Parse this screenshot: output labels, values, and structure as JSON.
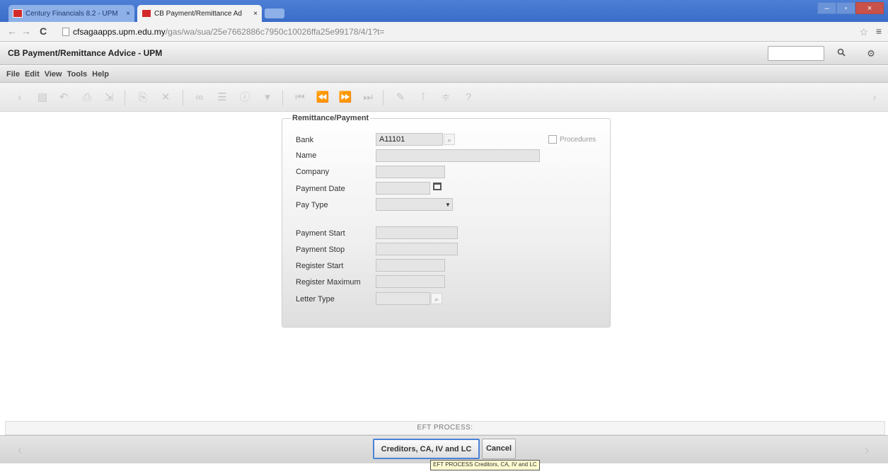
{
  "browser": {
    "tabs": [
      {
        "title": "Century Financials 8.2 - UPM",
        "active": false
      },
      {
        "title": "CB Payment/Remittance Ad",
        "active": true
      }
    ],
    "tab_close": "×",
    "url_host": "cfsagaapps.upm.edu.my",
    "url_path": "/gas/wa/sua/25e7662886c7950c10026ffa25e99178/4/1?t=",
    "window_buttons": {
      "minimize": "–",
      "maximize": "▫",
      "close": "×"
    },
    "icons": {
      "back": "←",
      "forward": "→",
      "reload": "C",
      "star": "☆",
      "menu": "≡"
    }
  },
  "app": {
    "title": "CB Payment/Remittance Advice - UPM",
    "search_icon": "🔍",
    "settings_icon": "⚙",
    "menu": [
      "File",
      "Edit",
      "View",
      "Tools",
      "Help"
    ]
  },
  "toolbar_icons": [
    "back-arrow",
    "document",
    "undo",
    "print",
    "export",
    "copy",
    "delete",
    "find",
    "list",
    "info",
    "dropdown",
    "first-record",
    "previous-record",
    "next-record",
    "last-record",
    "edit",
    "tag",
    "filter",
    "help"
  ],
  "form": {
    "legend": "Remittance/Payment",
    "fields": {
      "bank": {
        "label": "Bank",
        "value": "A11101"
      },
      "name": {
        "label": "Name",
        "value": ""
      },
      "company": {
        "label": "Company",
        "value": ""
      },
      "payment_date": {
        "label": "Payment Date",
        "value": ""
      },
      "pay_type": {
        "label": "Pay Type",
        "value": ""
      },
      "payment_start": {
        "label": "Payment Start",
        "value": ""
      },
      "payment_stop": {
        "label": "Payment Stop",
        "value": ""
      },
      "register_start": {
        "label": "Register Start",
        "value": ""
      },
      "register_maximum": {
        "label": "Register Maximum",
        "value": ""
      },
      "letter_type": {
        "label": "Letter Type",
        "value": ""
      }
    },
    "procedures_label": "Procedures",
    "procedures_checked": false
  },
  "footer": {
    "status": "EFT PROCESS:",
    "primary_button": "Creditors, CA, IV and LC",
    "cancel_button": "Cancel",
    "tooltip": "EFT PROCESS Creditors, CA, IV and LC"
  },
  "colors": {
    "tabbar": "#3a6dc8",
    "primary_border": "#4a82d8"
  }
}
